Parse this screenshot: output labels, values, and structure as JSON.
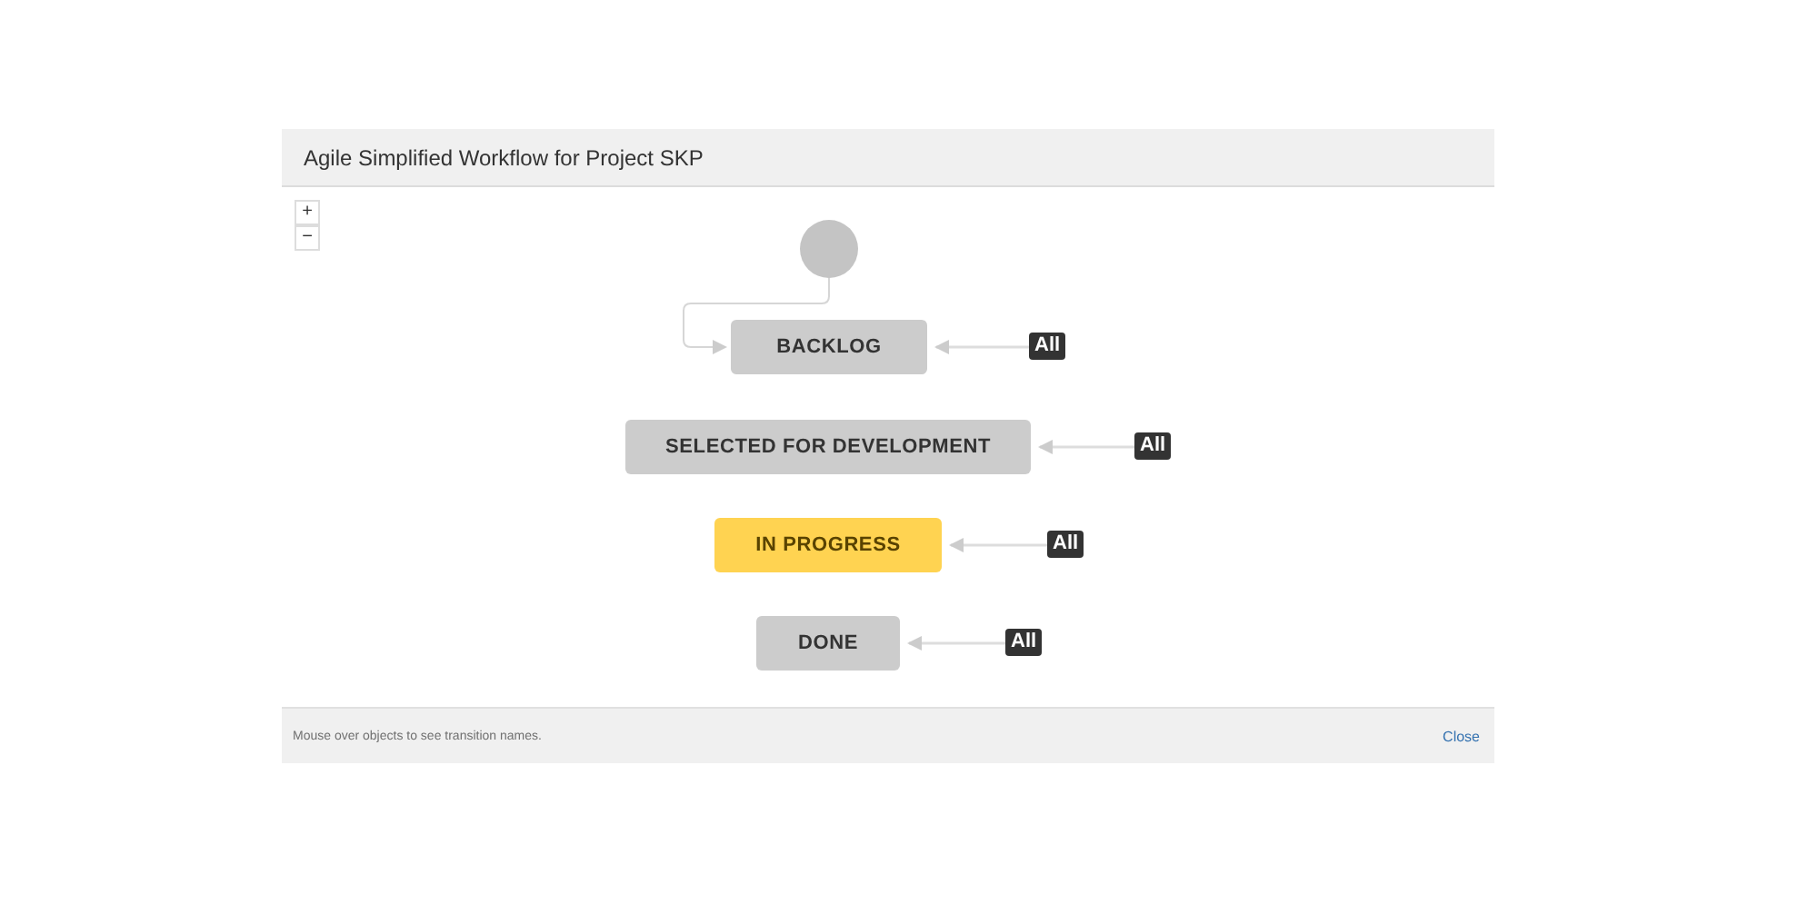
{
  "dialog": {
    "title": "Agile Simplified Workflow for Project SKP"
  },
  "zoom_controls": [
    "+",
    "−"
  ],
  "statuses": [
    {
      "name": "BACKLOG",
      "kind": "todo",
      "transition": "All"
    },
    {
      "name": "SELECTED FOR DEVELOPMENT",
      "kind": "todo",
      "transition": "All"
    },
    {
      "name": "IN PROGRESS",
      "kind": "inprogress",
      "transition": "All"
    },
    {
      "name": "DONE",
      "kind": "done",
      "transition": "All"
    }
  ],
  "footer": {
    "hint": "Mouse over objects to see transition names.",
    "close": "Close"
  }
}
